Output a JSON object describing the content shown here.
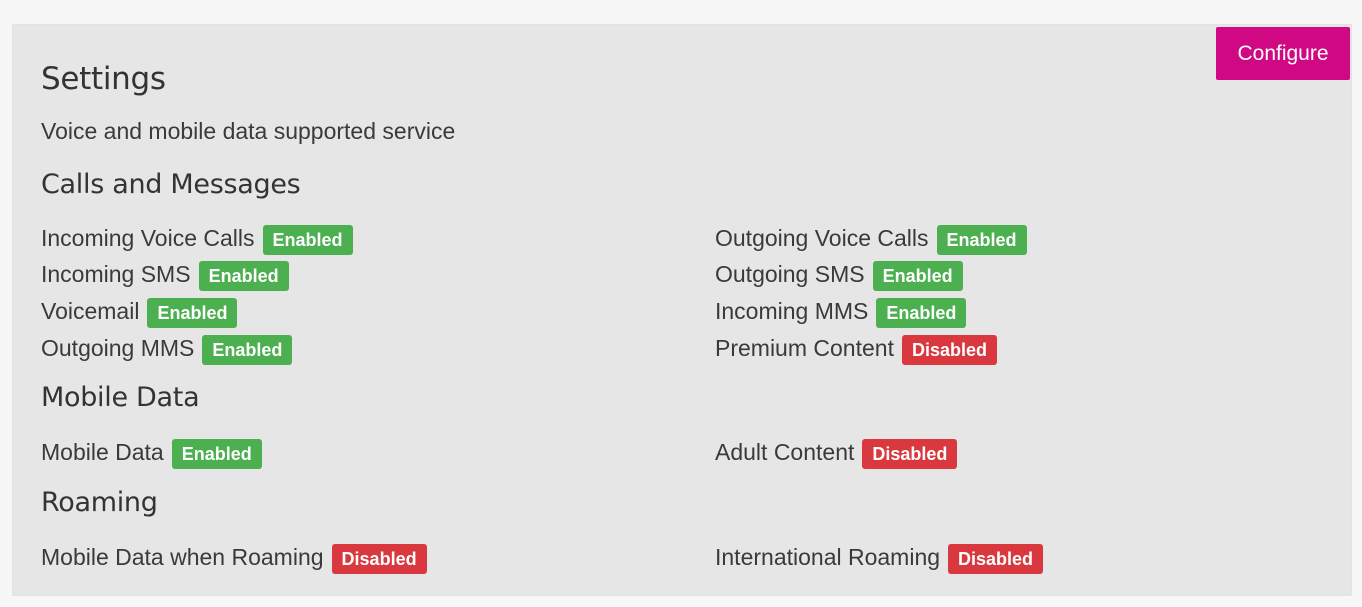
{
  "header": {
    "title": "Settings",
    "subtitle": "Voice and mobile data supported service",
    "configure_label": "Configure"
  },
  "colors": {
    "accent": "#d10884",
    "enabled": "#4caf50",
    "disabled": "#d9383e"
  },
  "sections": [
    {
      "heading": "Calls and Messages",
      "items": [
        {
          "label": "Incoming Voice Calls",
          "status": "Enabled"
        },
        {
          "label": "Outgoing Voice Calls",
          "status": "Enabled"
        },
        {
          "label": "Incoming SMS",
          "status": "Enabled"
        },
        {
          "label": "Outgoing SMS",
          "status": "Enabled"
        },
        {
          "label": "Voicemail",
          "status": "Enabled"
        },
        {
          "label": "Incoming MMS",
          "status": "Enabled"
        },
        {
          "label": "Outgoing MMS",
          "status": "Enabled"
        },
        {
          "label": "Premium Content",
          "status": "Disabled"
        }
      ]
    },
    {
      "heading": "Mobile Data",
      "items": [
        {
          "label": "Mobile Data",
          "status": "Enabled"
        },
        {
          "label": "Adult Content",
          "status": "Disabled"
        }
      ]
    },
    {
      "heading": "Roaming",
      "items": [
        {
          "label": "Mobile Data when Roaming",
          "status": "Disabled"
        },
        {
          "label": "International Roaming",
          "status": "Disabled"
        }
      ]
    }
  ]
}
